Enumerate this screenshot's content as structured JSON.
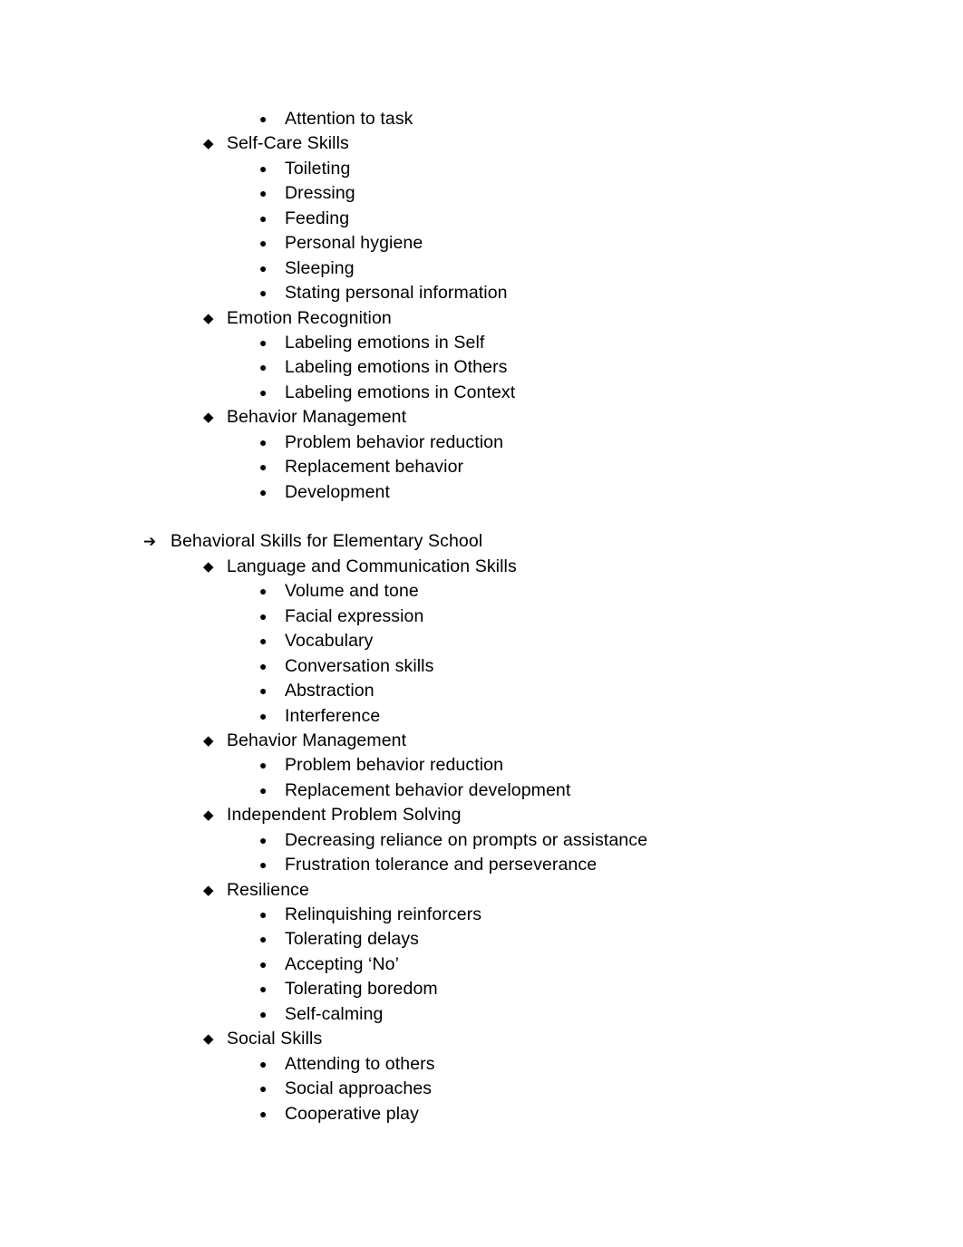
{
  "document": {
    "background_color": "#ffffff",
    "text_color": "#000000",
    "bullets": {
      "level1": "➔",
      "level2": "◆",
      "level3": "●"
    },
    "blocks": [
      {
        "level": 3,
        "bullet": "●",
        "text": "Attention to task"
      },
      {
        "level": 2,
        "bullet": "◆",
        "text": "Self-Care Skills"
      },
      {
        "level": 3,
        "bullet": "●",
        "text": "Toileting"
      },
      {
        "level": 3,
        "bullet": "●",
        "text": "Dressing"
      },
      {
        "level": 3,
        "bullet": "●",
        "text": "Feeding"
      },
      {
        "level": 3,
        "bullet": "●",
        "text": "Personal hygiene"
      },
      {
        "level": 3,
        "bullet": "●",
        "text": "Sleeping"
      },
      {
        "level": 3,
        "bullet": "●",
        "text": "Stating personal information"
      },
      {
        "level": 2,
        "bullet": "◆",
        "text": "Emotion Recognition"
      },
      {
        "level": 3,
        "bullet": "●",
        "text": "Labeling emotions in Self"
      },
      {
        "level": 3,
        "bullet": "●",
        "text": "Labeling emotions in Others"
      },
      {
        "level": 3,
        "bullet": "●",
        "text": "Labeling emotions in Context"
      },
      {
        "level": 2,
        "bullet": "◆",
        "text": "Behavior Management"
      },
      {
        "level": 3,
        "bullet": "●",
        "text": "Problem behavior reduction"
      },
      {
        "level": 3,
        "bullet": "●",
        "text": "Replacement behavior"
      },
      {
        "level": 3,
        "bullet": "●",
        "text": "Development"
      },
      {
        "level": 0,
        "bullet": "",
        "text": ""
      },
      {
        "level": 1,
        "bullet": "➔",
        "text": "Behavioral Skills for Elementary School"
      },
      {
        "level": 2,
        "bullet": "◆",
        "text": "Language and Communication Skills"
      },
      {
        "level": 3,
        "bullet": "●",
        "text": "Volume and tone"
      },
      {
        "level": 3,
        "bullet": "●",
        "text": "Facial expression"
      },
      {
        "level": 3,
        "bullet": "●",
        "text": "Vocabulary"
      },
      {
        "level": 3,
        "bullet": "●",
        "text": "Conversation skills"
      },
      {
        "level": 3,
        "bullet": "●",
        "text": "Abstraction"
      },
      {
        "level": 3,
        "bullet": "●",
        "text": "Interference"
      },
      {
        "level": 2,
        "bullet": "◆",
        "text": "Behavior Management"
      },
      {
        "level": 3,
        "bullet": "●",
        "text": "Problem behavior reduction"
      },
      {
        "level": 3,
        "bullet": "●",
        "text": "Replacement behavior development"
      },
      {
        "level": 2,
        "bullet": "◆",
        "text": "Independent Problem Solving"
      },
      {
        "level": 3,
        "bullet": "●",
        "text": "Decreasing reliance on prompts or assistance"
      },
      {
        "level": 3,
        "bullet": "●",
        "text": "Frustration tolerance and perseverance"
      },
      {
        "level": 2,
        "bullet": "◆",
        "text": "Resilience"
      },
      {
        "level": 3,
        "bullet": "●",
        "text": "Relinquishing reinforcers"
      },
      {
        "level": 3,
        "bullet": "●",
        "text": "Tolerating delays"
      },
      {
        "level": 3,
        "bullet": "●",
        "text": "Accepting ‘No’"
      },
      {
        "level": 3,
        "bullet": "●",
        "text": "Tolerating boredom"
      },
      {
        "level": 3,
        "bullet": "●",
        "text": "Self-calming"
      },
      {
        "level": 2,
        "bullet": "◆",
        "text": "Social Skills"
      },
      {
        "level": 3,
        "bullet": "●",
        "text": "Attending to others"
      },
      {
        "level": 3,
        "bullet": "●",
        "text": "Social approaches"
      },
      {
        "level": 3,
        "bullet": "●",
        "text": "Cooperative play"
      }
    ]
  }
}
